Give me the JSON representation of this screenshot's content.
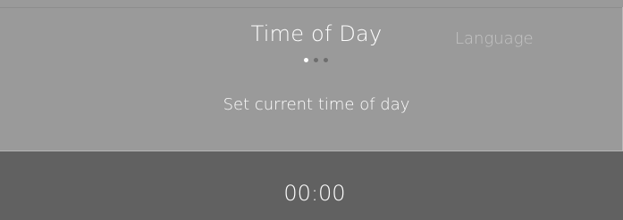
{
  "carousel": {
    "current_title": "Time of Day",
    "next_title": "Language",
    "page_count": 3,
    "active_page": 1
  },
  "description": "Set current time of day",
  "time_picker": {
    "value": "00:00"
  },
  "colors": {
    "background": "#9a9a9a",
    "panel": "#616161",
    "text": "#ffffff",
    "muted_text": "#c4c4c4",
    "active_dot": "#ffffff",
    "inactive_dot": "#6e6e6e"
  }
}
